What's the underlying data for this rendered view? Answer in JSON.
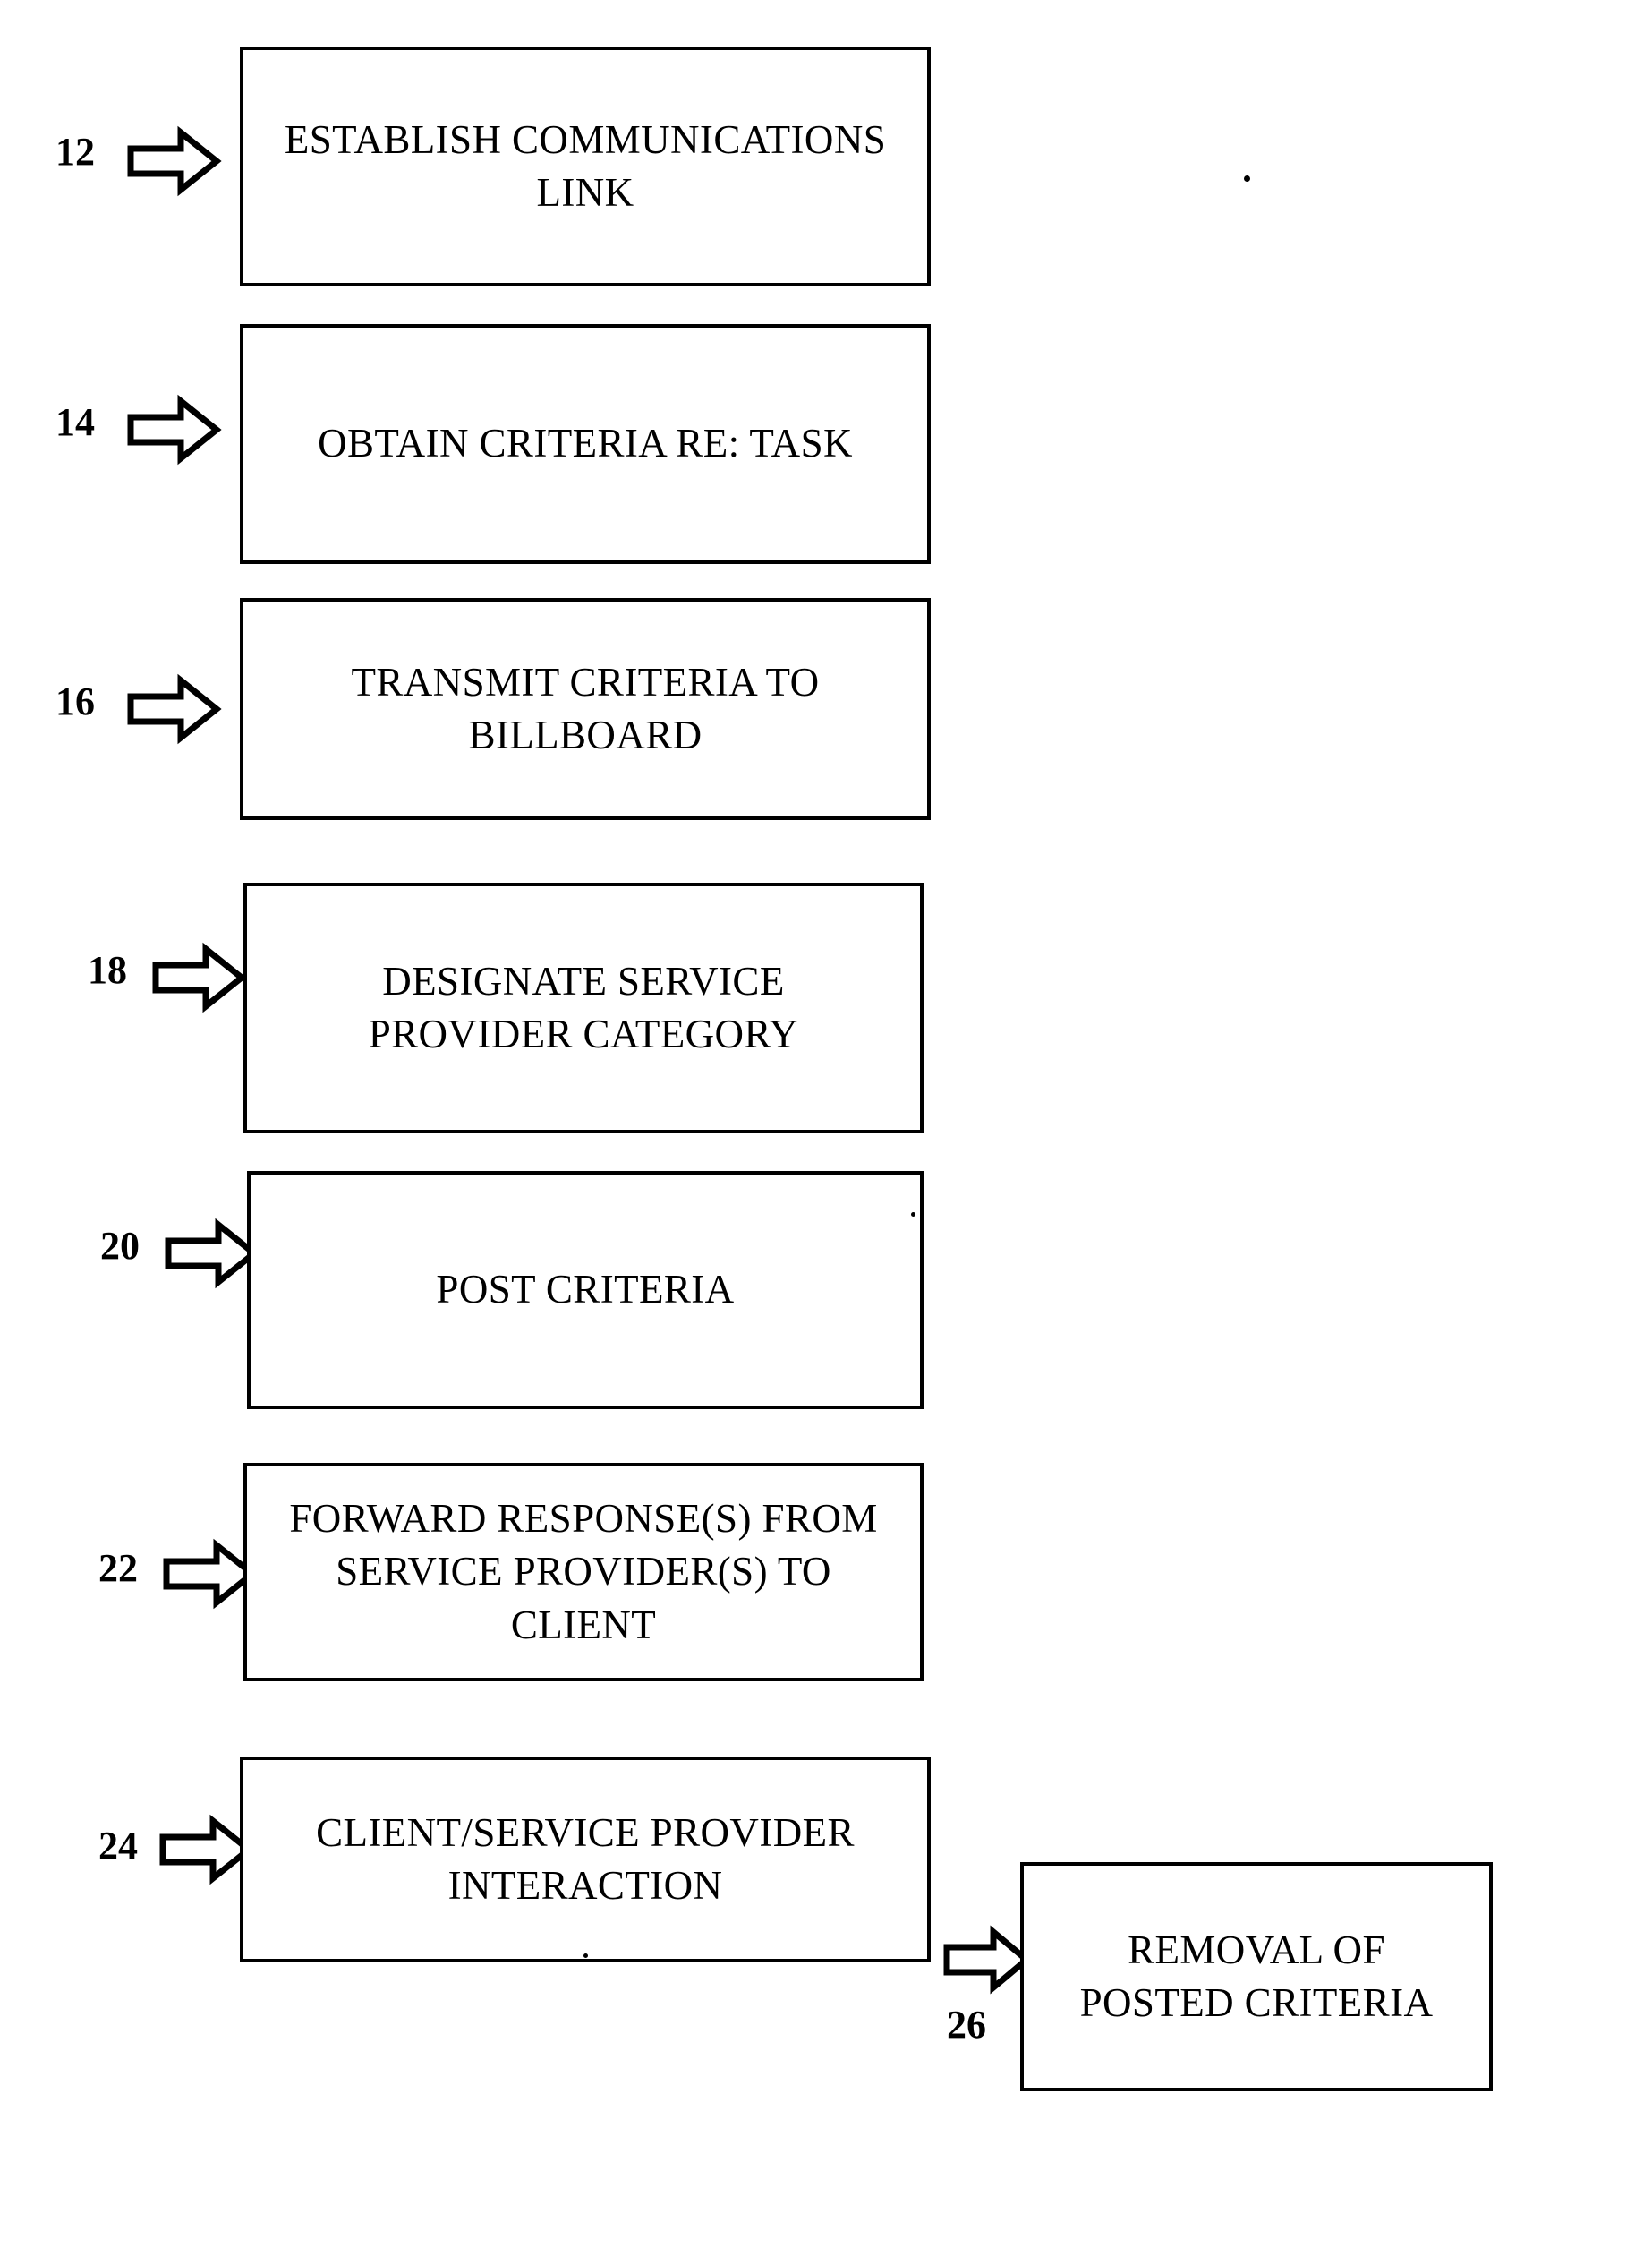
{
  "figure": {
    "type": "patent-flowchart",
    "orientation": "vertical-then-branch",
    "steps": [
      {
        "ref": "12",
        "label": "ESTABLISH COMMUNICATIONS\nLINK",
        "lines": [
          "ESTABLISH COMMUNICATIONS",
          "LINK"
        ]
      },
      {
        "ref": "14",
        "label": "OBTAIN CRITERIA RE: TASK",
        "lines": [
          "OBTAIN CRITERIA RE: TASK"
        ]
      },
      {
        "ref": "16",
        "label": "TRANSMIT CRITERIA TO\nBILLBOARD",
        "lines": [
          "TRANSMIT CRITERIA TO",
          "BILLBOARD"
        ]
      },
      {
        "ref": "18",
        "label": "DESIGNATE SERVICE\nPROVIDER CATEGORY",
        "lines": [
          "DESIGNATE SERVICE",
          "PROVIDER CATEGORY"
        ]
      },
      {
        "ref": "20",
        "label": "POST CRITERIA",
        "lines": [
          "POST CRITERIA"
        ]
      },
      {
        "ref": "22",
        "label": "FORWARD RESPONSE(S) FROM\nSERVICE PROVIDER(S) TO\nCLIENT",
        "lines": [
          "FORWARD RESPONSE(S) FROM",
          "SERVICE PROVIDER(S) TO",
          "CLIENT"
        ]
      },
      {
        "ref": "24",
        "label": "CLIENT/SERVICE PROVIDER\nINTERACTION",
        "lines": [
          "CLIENT/SERVICE PROVIDER",
          "INTERACTION"
        ]
      },
      {
        "ref": "26",
        "label": "REMOVAL OF\nPOSTED CRITERIA",
        "lines": [
          "REMOVAL OF",
          "POSTED CRITERIA"
        ]
      }
    ],
    "colors": {
      "ink": "#000000",
      "paper": "#ffffff"
    }
  }
}
